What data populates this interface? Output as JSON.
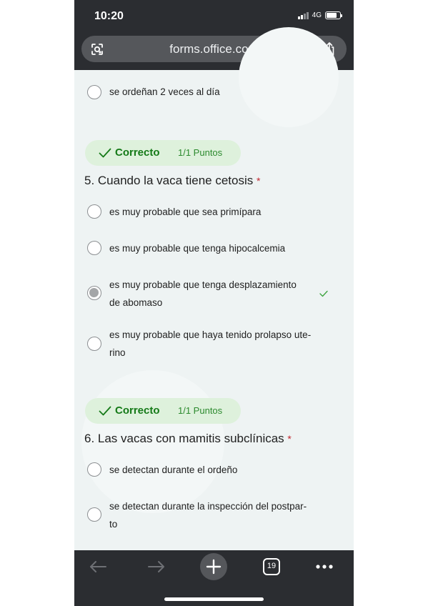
{
  "status_bar": {
    "time": "10:20",
    "network": "4G"
  },
  "browser": {
    "url": "forms.office.com",
    "tab_count": "19"
  },
  "prev_question": {
    "options": [
      {
        "label": "se ordeñan 2 veces al día",
        "selected": false
      }
    ]
  },
  "questions": [
    {
      "badge": {
        "label": "Correcto",
        "points": "1/1 Puntos"
      },
      "title": "5. Cuando la vaca tiene cetosis",
      "required_mark": "*",
      "options": [
        {
          "line1": "es muy probable que sea primípara",
          "line2": "",
          "selected": false
        },
        {
          "line1": "es muy probable que tenga hipocalcemia",
          "line2": "",
          "selected": false
        },
        {
          "line1": "es muy probable que tenga desplazamiento",
          "line2": "de abomaso",
          "selected": true,
          "correct": true
        },
        {
          "line1": "es muy probable que haya tenido prolapso ute-",
          "line2": "rino",
          "selected": false
        }
      ]
    },
    {
      "badge": {
        "label": "Correcto",
        "points": "1/1 Puntos"
      },
      "title": "6. Las vacas con mamitis subclínicas",
      "required_mark": "*",
      "options": [
        {
          "line1": "se detectan durante el ordeño",
          "line2": "",
          "selected": false
        },
        {
          "line1": "se detectan durante la inspección del postpar-",
          "line2": "to",
          "selected": false
        }
      ]
    }
  ],
  "colors": {
    "accent_green": "#157a18",
    "badge_bg": "#def1dc",
    "required_red": "#c2262e",
    "chrome_dark": "#2b2d31"
  }
}
